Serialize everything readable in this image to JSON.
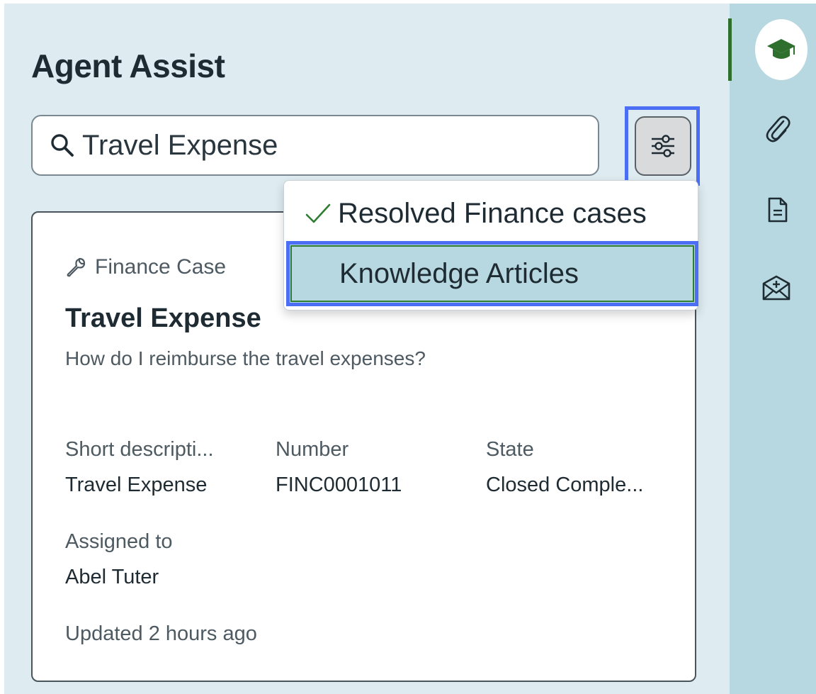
{
  "header": {
    "title": "Agent Assist"
  },
  "search": {
    "value": "Travel Expense",
    "icon": "search-icon"
  },
  "filter": {
    "icon": "sliders-icon",
    "options": [
      {
        "label": "Resolved Finance cases",
        "checked": true
      },
      {
        "label": "Knowledge Articles",
        "checked": false,
        "highlighted": true
      }
    ]
  },
  "card": {
    "type_label": "Finance Case",
    "type_icon": "wrench-icon",
    "title": "Travel Expense",
    "description": "How do I reimburse the travel expenses?",
    "fields": [
      {
        "label": "Short descripti...",
        "value": "Travel Expense"
      },
      {
        "label": "Number",
        "value": "FINC0001011"
      },
      {
        "label": "State",
        "value": "Closed Comple..."
      },
      {
        "label": "Assigned to",
        "value": "Abel Tuter"
      }
    ],
    "updated": "Updated 2 hours ago"
  },
  "rail": {
    "items": [
      {
        "icon": "graduation-cap-icon",
        "active": true
      },
      {
        "icon": "paperclip-icon",
        "active": false
      },
      {
        "icon": "document-icon",
        "active": false
      },
      {
        "icon": "envelope-plus-icon",
        "active": false
      }
    ]
  },
  "colors": {
    "panel_bg": "#deecf1",
    "rail_bg": "#b7d8e0",
    "accent_green": "#2e6f2e",
    "focus_blue": "#4b6ef5"
  }
}
